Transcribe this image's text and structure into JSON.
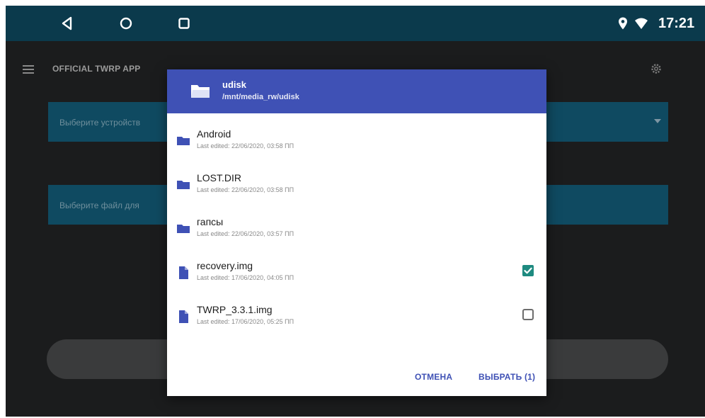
{
  "status_bar": {
    "time": "17:21",
    "icons": [
      "back-icon",
      "home-icon",
      "recent-apps-icon",
      "location-icon",
      "wifi-icon"
    ]
  },
  "app": {
    "title": "OFFICIAL TWRP APP",
    "device_select_placeholder": "Выберите устройств",
    "file_select_placeholder": "Выберите файл для",
    "accent_color": "#0f4a61"
  },
  "dialog": {
    "folder_name": "udisk",
    "folder_path": "/mnt/media_rw/udisk",
    "header_color": "#3f51b5",
    "items": [
      {
        "name": "Android",
        "edited": "Last edited: 22/06/2020, 03:58 ПП",
        "type": "folder"
      },
      {
        "name": "LOST.DIR",
        "edited": "Last edited: 22/06/2020, 03:58 ПП",
        "type": "folder"
      },
      {
        "name": "гапсы",
        "edited": "Last edited: 22/06/2020, 03:57 ПП",
        "type": "folder"
      },
      {
        "name": "recovery.img",
        "edited": "Last edited: 17/06/2020, 04:05 ПП",
        "type": "file",
        "checked": true
      },
      {
        "name": "TWRP_3.3.1.img",
        "edited": "Last edited: 17/06/2020, 05:25 ПП",
        "type": "file",
        "checked": false
      }
    ],
    "cancel_label": "ОТМЕНА",
    "select_label": "ВЫБРАТЬ (1)"
  }
}
